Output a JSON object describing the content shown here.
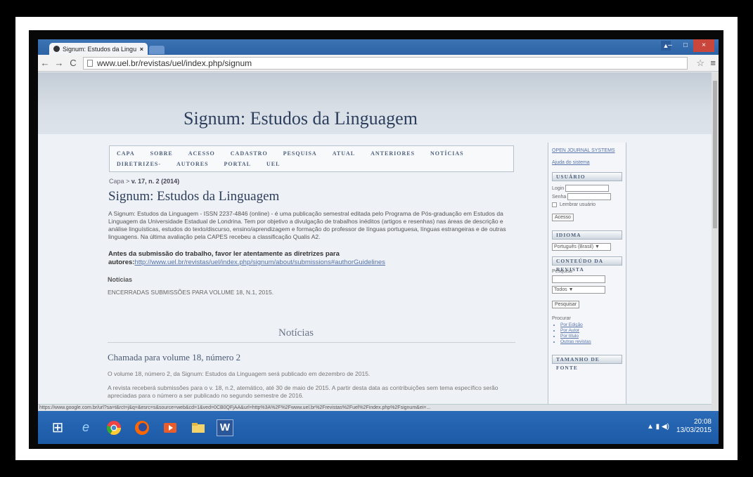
{
  "browser": {
    "tab_title": "Signum: Estudos da Lingu",
    "tab_close": "×",
    "url": "www.uel.br/revistas/uel/index.php/signum",
    "back": "←",
    "forward": "→",
    "reload": "C",
    "star": "☆",
    "menu": "≡"
  },
  "site": {
    "header_title": "Signum: Estudos da Linguagem",
    "nav_items": [
      "CAPA",
      "SOBRE",
      "ACESSO",
      "CADASTRO",
      "PESQUISA",
      "ATUAL",
      "ANTERIORES",
      "NOTÍCIAS",
      "DIRETRIZES-",
      "AUTORES",
      "PORTAL",
      "UEL"
    ]
  },
  "main": {
    "breadcrumb_prefix": "Capa >",
    "breadcrumb_current": "v. 17, n. 2 (2014)",
    "title": "Signum: Estudos da Linguagem",
    "intro": "A Signum: Estudos da Linguagem - ISSN 2237-4846 (online) - é uma publicação semestral editada pelo Programa de Pós-graduação em Estudos da Linguagem da Universidade Estadual de Londrina. Tem por objetivo a divulgação de trabalhos inéditos (artigos e resenhas) nas áreas de descrição e análise linguísticas, estudos do texto/discurso, ensino/aprendizagem e formação do professor de línguas portuguesa, línguas estrangeiras e de outras linguagens. Na última avaliação pela CAPES recebeu a classificação Qualis A2.",
    "submission_text": "Antes da submissão do trabalho, favor ler atentamente as diretrizes para autores:",
    "submission_link": "http://www.uel.br/revistas/uel/index.php/signum/about/submissions#authorGuidelines",
    "news_label": "Notícias",
    "news_line": "ENCERRADAS SUBMISSÕES PARA VOLUME 18, N.1, 2015.",
    "news_heading": "Notícias",
    "call_title": "Chamada para volume 18, número 2",
    "call_p1": "O volume 18, número 2, da Signum: Estudos da Linguagem será publicado em dezembro de 2015.",
    "call_p2": "A revista receberá submissões para o v. 18, n.2, atemático, até 30 de maio de 2015. A partir desta data as contribuições sem tema específico serão apreciadas para o número a ser publicado no segundo semestre de 2016."
  },
  "sidebar": {
    "ojs_link": "OPEN JOURNAL SYSTEMS",
    "help_link": "Ajuda do sistema",
    "user_head": "USUÁRIO",
    "login_label": "Login",
    "password_label": "Senha",
    "remember_label": "Lembrar usuário",
    "access_button": "Acesso",
    "language_head": "IDIOMA",
    "language_value": "Português (Brasil) ▼",
    "content_head": "CONTEÚDO DA REVISTA",
    "search_label": "Pesquisa",
    "scope_value": "Todos ▼",
    "search_button": "Pesquisar",
    "browse_label": "Procurar",
    "browse_links": [
      "Por Edição",
      "Por Autor",
      "Por título",
      "Outras revistas"
    ],
    "font_head": "TAMANHO DE FONTE"
  },
  "statusbar": {
    "text": "https://www.google.com.br/url?sa=t&rct=j&q=&esrc=s&source=web&cd=1&ved=0CB0QFjAA&url=http%3A%2F%2Fwww.uel.br%2Frevistas%2Fuel%2Findex.php%2Fsignum&ei=..."
  },
  "taskbar": {
    "start": "⊞",
    "ie": "e",
    "word": "W",
    "time": "20:08",
    "date": "13/03/2015"
  }
}
